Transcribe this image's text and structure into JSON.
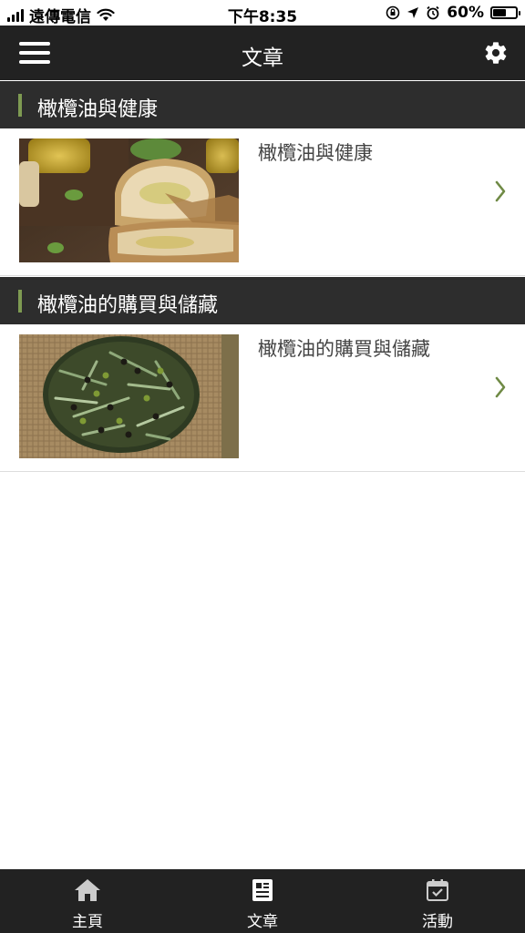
{
  "status_bar": {
    "carrier": "遠傳電信",
    "time": "下午8:35",
    "battery_percent": "60%",
    "battery_level": 0.6
  },
  "navbar": {
    "title": "文章",
    "menu_icon": "hamburger-menu-icon",
    "settings_icon": "gear-icon"
  },
  "sections": [
    {
      "header": "橄欖油與健康",
      "article_title": "橄欖油與健康",
      "image": "olive-oil-bread-photo"
    },
    {
      "header": "橄欖油的購買與儲藏",
      "article_title": "橄欖油的購買與儲藏",
      "image": "olive-harvest-sack-photo"
    }
  ],
  "tabbar": {
    "tabs": [
      {
        "label": "主頁",
        "icon": "home-icon"
      },
      {
        "label": "文章",
        "icon": "article-icon"
      },
      {
        "label": "活動",
        "icon": "calendar-check-icon"
      }
    ]
  },
  "colors": {
    "bar_dark": "#222222",
    "section_dark": "#2d2d2d",
    "accent_green": "#7e9a52"
  }
}
